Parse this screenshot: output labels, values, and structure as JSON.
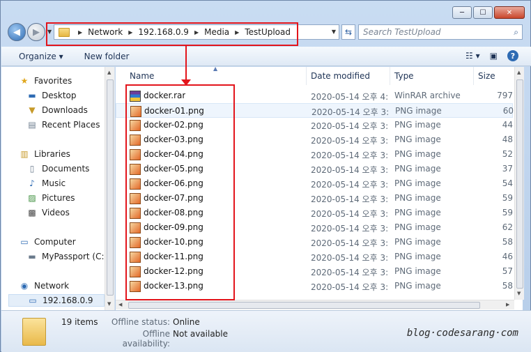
{
  "window": {
    "controls": [
      "─",
      "☐",
      "✕"
    ]
  },
  "address": {
    "crumbs": [
      "Network",
      "192.168.0.9",
      "Media",
      "TestUpload"
    ]
  },
  "search": {
    "placeholder": "Search TestUpload"
  },
  "toolbar": {
    "organize": "Organize ▾",
    "new_folder": "New folder"
  },
  "sidebar": {
    "favorites": "Favorites",
    "fav_items": [
      "Desktop",
      "Downloads",
      "Recent Places"
    ],
    "libraries": "Libraries",
    "lib_items": [
      "Documents",
      "Music",
      "Pictures",
      "Videos"
    ],
    "computer": "Computer",
    "comp_items": [
      "MyPassport (C:)"
    ],
    "network": "Network",
    "net_items": [
      "192.168.0.9"
    ]
  },
  "columns": {
    "name": "Name",
    "date": "Date modified",
    "type": "Type",
    "size": "Size"
  },
  "files": [
    {
      "name": "docker.rar",
      "date": "2020-05-14 오후 4:...",
      "type": "WinRAR archive",
      "size": "797",
      "kind": "rar"
    },
    {
      "name": "docker-01.png",
      "date": "2020-05-14 오후 3:...",
      "type": "PNG image",
      "size": "60",
      "kind": "png"
    },
    {
      "name": "docker-02.png",
      "date": "2020-05-14 오후 3:...",
      "type": "PNG image",
      "size": "44",
      "kind": "png"
    },
    {
      "name": "docker-03.png",
      "date": "2020-05-14 오후 3:...",
      "type": "PNG image",
      "size": "48",
      "kind": "png"
    },
    {
      "name": "docker-04.png",
      "date": "2020-05-14 오후 3:...",
      "type": "PNG image",
      "size": "52",
      "kind": "png"
    },
    {
      "name": "docker-05.png",
      "date": "2020-05-14 오후 3:...",
      "type": "PNG image",
      "size": "37",
      "kind": "png"
    },
    {
      "name": "docker-06.png",
      "date": "2020-05-14 오후 3:...",
      "type": "PNG image",
      "size": "54",
      "kind": "png"
    },
    {
      "name": "docker-07.png",
      "date": "2020-05-14 오후 3:...",
      "type": "PNG image",
      "size": "59",
      "kind": "png"
    },
    {
      "name": "docker-08.png",
      "date": "2020-05-14 오후 3:...",
      "type": "PNG image",
      "size": "59",
      "kind": "png"
    },
    {
      "name": "docker-09.png",
      "date": "2020-05-14 오후 3:...",
      "type": "PNG image",
      "size": "62",
      "kind": "png"
    },
    {
      "name": "docker-10.png",
      "date": "2020-05-14 오후 3:...",
      "type": "PNG image",
      "size": "58",
      "kind": "png"
    },
    {
      "name": "docker-11.png",
      "date": "2020-05-14 오후 3:...",
      "type": "PNG image",
      "size": "46",
      "kind": "png"
    },
    {
      "name": "docker-12.png",
      "date": "2020-05-14 오후 3:...",
      "type": "PNG image",
      "size": "57",
      "kind": "png"
    },
    {
      "name": "docker-13.png",
      "date": "2020-05-14 오후 3:...",
      "type": "PNG image",
      "size": "58",
      "kind": "png"
    }
  ],
  "details": {
    "count": "19 items",
    "offline_status_label": "Offline status:",
    "offline_status_value": "Online",
    "offline_avail_label": "Offline availability:",
    "offline_avail_value": "Not available"
  },
  "watermark": "blog·codesarang·com",
  "colors": {
    "accent": "#2e6bb3",
    "highlight": "#e3141b"
  }
}
